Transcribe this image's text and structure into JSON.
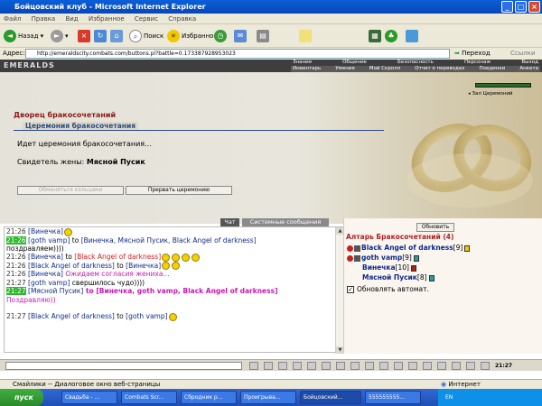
{
  "window": {
    "title": "Бойцовский клуб - Microsoft Internet Explorer"
  },
  "menu": [
    "Файл",
    "Правка",
    "Вид",
    "Избранное",
    "Сервис",
    "Справка"
  ],
  "toolbar": {
    "back": "Назад",
    "search": "Поиск",
    "favorites": "Избранное",
    "go": "Переход",
    "links": "Ссылки"
  },
  "address": {
    "label": "Адрес:",
    "url": "http://emeraldscity.combats.com/buttons.pl?battle=0.173387928953023"
  },
  "game": {
    "logo": "EMERALDS",
    "nav_top": [
      "Знания",
      "Общение",
      "Безопасность",
      "Персонаж",
      "Выход"
    ],
    "nav_bottom": [
      "Инвентарь",
      "Умения",
      "Мой Скролл",
      "Отчет о переводах",
      "Поединки",
      "Анкета"
    ],
    "exit_ceremony": "Зал Церемоний"
  },
  "palace": {
    "title": "Дворец бракосочетаний",
    "subtitle": "Церемония бракосочетания",
    "status": "Идет церемония бракосочетания...",
    "witness_label": "Свидетель жены:",
    "witness_name": "Мясной Пусик",
    "btn_exchange": "Обменяться кольцами",
    "btn_stop": "Прервать церемонию"
  },
  "tabs": {
    "chat": "Чат",
    "system": "Системные сообщения"
  },
  "chat": [
    {
      "time": "21:26",
      "hl": false,
      "from": "[Винечка]",
      "to_prefix": "",
      "to": "",
      "text": "",
      "emo": 1,
      "cls": ""
    },
    {
      "time": "21:26",
      "hl": true,
      "from": "[goth vamp]",
      "to_prefix": " to ",
      "to": "[Винечка, Мясной Пусик, Black Angel of darkness]",
      "text": "",
      "emo": 0,
      "cls": ""
    },
    {
      "time": "",
      "hl": false,
      "from": "",
      "to_prefix": "",
      "to": "",
      "text": "поздравляем))))",
      "emo": 0,
      "cls": ""
    },
    {
      "time": "21:26",
      "hl": false,
      "from": "[Винечка]",
      "to_prefix": " to ",
      "to": "[Black Angel of darkness]",
      "text": "",
      "emo": 4,
      "cls": "red"
    },
    {
      "time": "21:26",
      "hl": false,
      "from": "[Black Angel of darkness]",
      "to_prefix": " to ",
      "to": "[Винечка]",
      "text": "",
      "emo": 2,
      "cls": ""
    },
    {
      "time": "21:26",
      "hl": false,
      "from": "[Винечка]",
      "to_prefix": "",
      "to": "",
      "text": " Ожидаем согласия жениха...",
      "emo": 0,
      "cls": "pink"
    },
    {
      "time": "21:27",
      "hl": false,
      "from": "[goth vamp]",
      "to_prefix": "",
      "to": "",
      "text": " свершилось чудо))))",
      "emo": 0,
      "cls": ""
    },
    {
      "time": "21:27",
      "hl": true,
      "from": "[Мясной Пусик]",
      "to_prefix": " to ",
      "to": "[Винечка, goth vamp, Black Angel of darkness]",
      "text": "",
      "emo": 0,
      "cls": "pinkb"
    },
    {
      "time": "",
      "hl": false,
      "from": "",
      "to_prefix": "",
      "to": "",
      "text": "Поздравляю))",
      "emo": 0,
      "cls": "pink"
    },
    {
      "time": "",
      "hl": false,
      "from": "",
      "to_prefix": "",
      "to": "",
      "text": "",
      "emo": 0,
      "cls": ""
    },
    {
      "time": "21:27",
      "hl": false,
      "from": "[Black Angel of darkness]",
      "to_prefix": " to ",
      "to": "[goth vamp]",
      "text": "",
      "emo": 1,
      "cls": ""
    }
  ],
  "altar": {
    "refresh": "Обновить",
    "title": "Алтарь Бракосочетаний (4)",
    "people": [
      {
        "name": "Black Angel of darkness",
        "level": "[9]"
      },
      {
        "name": "goth vamp",
        "level": "[9]"
      },
      {
        "name": "Винечка",
        "level": "[10]"
      },
      {
        "name": "Мясной Пусик",
        "level": "[8]"
      }
    ],
    "autorefresh": "Обновлять автомат."
  },
  "status": {
    "text": "Смайлики -- Диалоговое окно веб-страницы",
    "zone": "Интернет"
  },
  "taskbar": {
    "start": "пуск",
    "tasks": [
      "Свадьба - ...",
      "Combats Scr...",
      "Сбродник р...",
      "Проигрыва...",
      "Бойцовский...",
      "555555555..."
    ],
    "lang": "EN"
  },
  "clock": "21:27",
  "colors": {
    "chat_bg": "#ffffff",
    "highlight": "#2db82d",
    "link": "#102a8a",
    "pink": "#c81ab0",
    "heading": "#8b1a1a"
  }
}
